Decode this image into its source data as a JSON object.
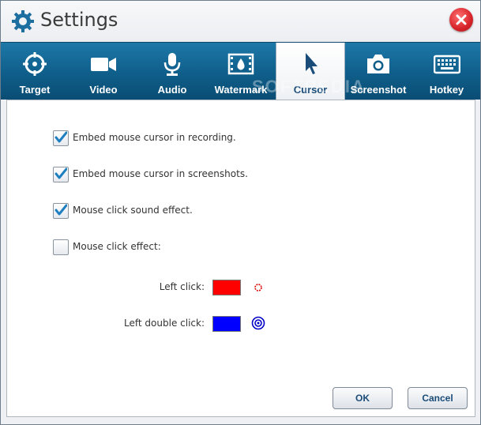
{
  "window": {
    "title": "Settings"
  },
  "tabs": [
    {
      "label": "Target",
      "icon": "target-icon"
    },
    {
      "label": "Video",
      "icon": "video-camera-icon"
    },
    {
      "label": "Audio",
      "icon": "microphone-icon"
    },
    {
      "label": "Watermark",
      "icon": "film-droplet-icon"
    },
    {
      "label": "Cursor",
      "icon": "cursor-arrow-icon",
      "active": true
    },
    {
      "label": "Screenshot",
      "icon": "camera-icon"
    },
    {
      "label": "Hotkey",
      "icon": "keyboard-icon"
    }
  ],
  "cursor_settings": {
    "options": [
      {
        "label": "Embed mouse cursor in recording.",
        "checked": true
      },
      {
        "label": "Embed mouse cursor in screenshots.",
        "checked": true
      },
      {
        "label": "Mouse click sound effect.",
        "checked": true
      },
      {
        "label": "Mouse click effect:",
        "checked": false
      }
    ],
    "left_click": {
      "label": "Left click:",
      "color": "#ff0000",
      "preview_icon": "red-dotted-circle-icon"
    },
    "left_double_click": {
      "label": "Left double click:",
      "color": "#0000ff",
      "preview_icon": "blue-double-circle-icon"
    }
  },
  "buttons": {
    "ok": "OK",
    "cancel": "Cancel"
  },
  "watermark_text": "SOFTPEDIA",
  "colors": {
    "tab_bar": "#0f5e8a",
    "accent_text": "#1a4c79",
    "checkmark": "#1e7fc0"
  }
}
